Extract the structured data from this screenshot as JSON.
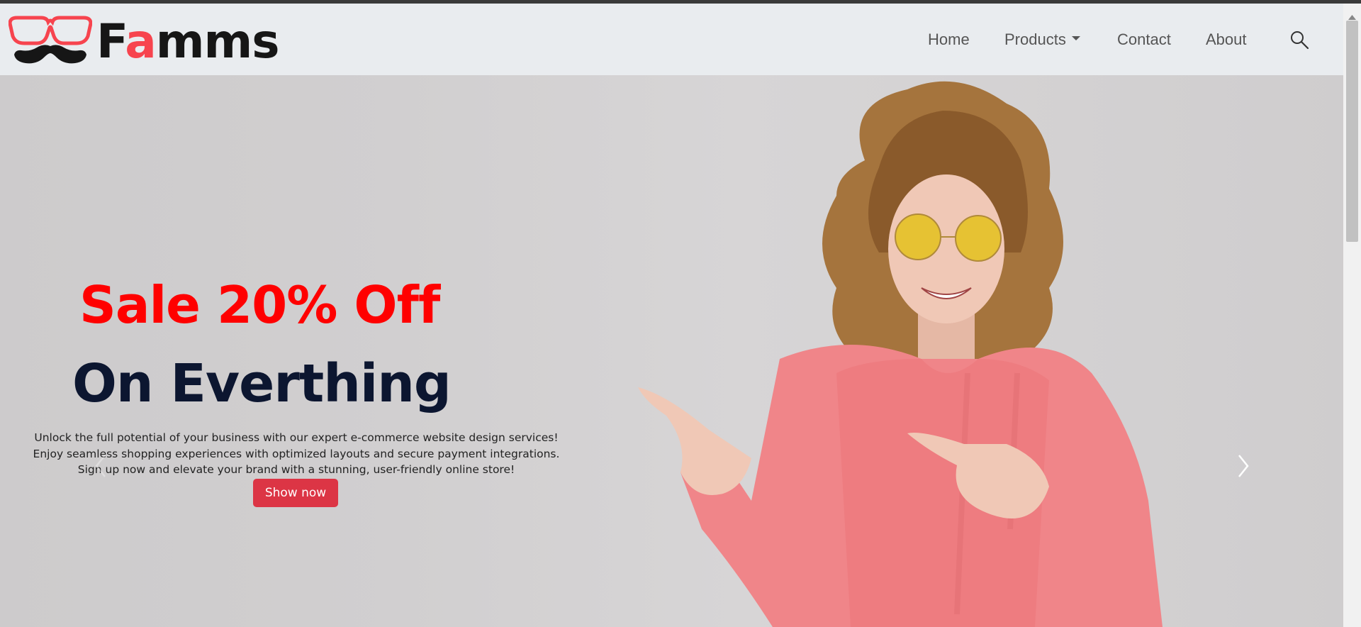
{
  "brand": {
    "text_before": "F",
    "text_accent": "a",
    "text_after": "mms",
    "accent_color": "#f7444e",
    "icon": "glasses-mustache-logo"
  },
  "nav": {
    "home": "Home",
    "products": "Products",
    "contact": "Contact",
    "about": "About",
    "search_icon": "search-icon"
  },
  "hero": {
    "title": "Sale 20% Off",
    "subtitle": "On Everthing",
    "description": [
      "Unlock the full potential of your business with our expert e-commerce website design services!",
      "Enjoy seamless shopping experiences with optimized layouts and secure payment integrations.",
      "Sign up now and elevate your brand with a stunning, user-friendly online store!"
    ],
    "button": "Show now",
    "title_color": "#ff0000",
    "subtitle_color": "#0c1630",
    "button_color": "#dc3545"
  },
  "carousel": {
    "prev_icon": "chevron-left-icon",
    "next_icon": "chevron-right-icon"
  }
}
